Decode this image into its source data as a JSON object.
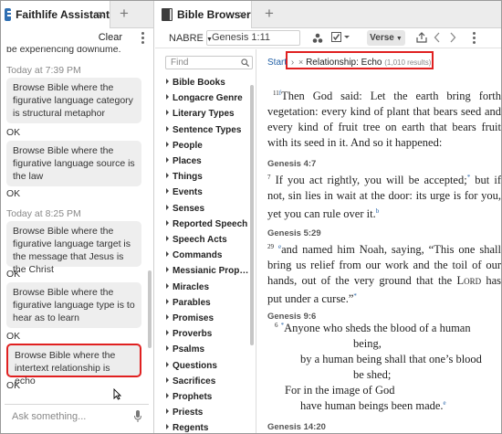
{
  "left_panel": {
    "tab_title": "Faithlife Assistant",
    "tab_close": "×",
    "tab_add": "+",
    "clear_label": "Clear",
    "partial_line": "be experiencing downume.",
    "time1": "Today at 7:39 PM",
    "msg1": "Browse Bible where the figurative language category is structural metaphor",
    "reply1": "OK",
    "msg2": "Browse Bible where the figurative language source is the law",
    "reply2": "OK",
    "time2": "Today at 8:25 PM",
    "msg3": "Browse Bible where the figurative language target is the message that Jesus is the Christ",
    "reply3": "OK",
    "msg4": "Browse Bible where the figurative language type is to hear as to learn",
    "reply4": "OK",
    "msg5": "Browse Bible where the intertext relationship is echo",
    "reply5": "OK",
    "ask_placeholder": "Ask something..."
  },
  "right_panel": {
    "tab_title": "Bible Browser",
    "tab_close": "×",
    "tab_add": "+",
    "version": "NABRE",
    "reference": "Genesis 1:11",
    "view_mode": "Verse",
    "find_placeholder": "Find",
    "sidebar_items": [
      "Bible Books",
      "Longacre Genre",
      "Literary Types",
      "Sentence Types",
      "People",
      "Places",
      "Things",
      "Events",
      "Senses",
      "Reported Speech",
      "Speech Acts",
      "Commands",
      "Messianic Prop…",
      "Miracles",
      "Parables",
      "Promises",
      "Proverbs",
      "Psalms",
      "Questions",
      "Sacrifices",
      "Prophets",
      "Priests",
      "Regents"
    ],
    "breadcrumb": {
      "start": "Start",
      "sep": "›",
      "remove": "×",
      "filter": "Relationship: Echo",
      "count": "(1,010 results)"
    },
    "passages": [
      {
        "ref": "Genesis 1:11",
        "num": "11",
        "fn": "f",
        "text": "Then God said: Let the earth bring forth vegetation: every kind of plant that bears seed and every kind of fruit tree on earth that bears fruit with its seed in it. And so it happened:"
      },
      {
        "ref": "Genesis 4:7",
        "num": "7",
        "text_a": "If you act rightly, you will be accepted;",
        "fn_a": "*",
        "text_b": " but if not, sin lies in wait at the door: its urge is for you, yet you can rule over it.",
        "fn_b": "b"
      },
      {
        "ref": "Genesis 5:29",
        "num": "29",
        "fn": "e",
        "text_a": "and named him Noah, saying, “This one shall bring us relief from our work and the toil of our hands, out of the very ground that the ",
        "lord": "Lord",
        "text_b": " has put under a curse.”",
        "fn_b": "*"
      },
      {
        "ref": "Genesis 9:6",
        "num": "6",
        "fn": "*",
        "lines": [
          "Anyone who sheds the blood of a human",
          "being,",
          "by a human being shall that one’s blood",
          "be shed;",
          "For in the image of God",
          "have human beings been made."
        ],
        "fn_end": "e"
      },
      {
        "ref": "Genesis 14:20"
      }
    ]
  }
}
